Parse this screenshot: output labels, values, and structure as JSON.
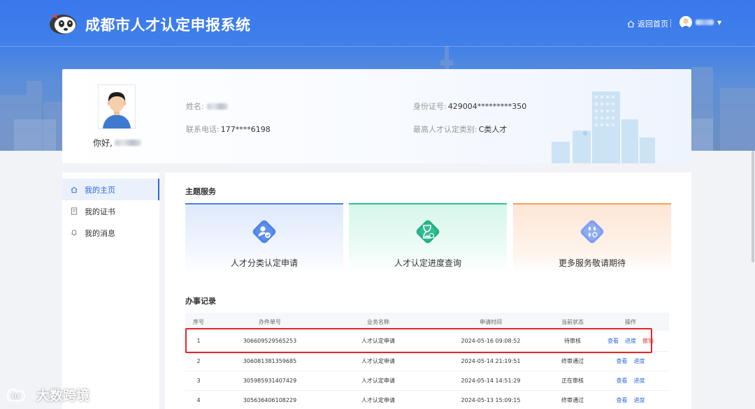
{
  "header": {
    "site_title": "成都市人才认定申报系统",
    "back_home": "返回首页",
    "user_name": ""
  },
  "profile": {
    "greeting": "你好,",
    "name_label": "姓名:",
    "phone_label": "联系电话:",
    "phone_value": "177****6198",
    "id_label": "身份证号:",
    "id_value": "429004*********350",
    "category_label": "最高人才认定类别:",
    "category_value": "C类人才"
  },
  "sidebar": {
    "items": [
      {
        "label": "我的主页",
        "icon": "home-icon",
        "active": true
      },
      {
        "label": "我的证书",
        "icon": "certificate-icon",
        "active": false
      },
      {
        "label": "我的消息",
        "icon": "bell-icon",
        "active": false
      }
    ]
  },
  "main": {
    "services_title": "主题服务",
    "services": [
      {
        "label": "人才分类认定申请",
        "icon": "user-check-icon",
        "accent": "#4a7fe6"
      },
      {
        "label": "人才认定进度查询",
        "icon": "hourglass-search-icon",
        "accent": "#2fc29a"
      },
      {
        "label": "更多服务敬请期待",
        "icon": "grid-more-icon",
        "accent": "#f1a45a"
      }
    ],
    "records_title": "办事记录",
    "table": {
      "headers": [
        "序号",
        "办件单号",
        "业务名称",
        "申请时间",
        "当前状态",
        "操作"
      ],
      "rows": [
        {
          "no": "1",
          "order": "306609529565253",
          "business": "人才认定申请",
          "time": "2024-05-16 09:08:52",
          "status": "待审核",
          "actions": [
            "查看",
            "进度",
            "撤销"
          ]
        },
        {
          "no": "2",
          "order": "306081381359685",
          "business": "人才认定申请",
          "time": "2024-05-14 21:19:51",
          "status": "终审通过",
          "actions": [
            "查看",
            "进度"
          ]
        },
        {
          "no": "3",
          "order": "305985931407429",
          "business": "人才认定申请",
          "time": "2024-05-14 14:51:29",
          "status": "正在审核",
          "actions": [
            "查看",
            "进度"
          ]
        },
        {
          "no": "4",
          "order": "305636406108229",
          "business": "人才认定申请",
          "time": "2024-05-13 15:09:15",
          "status": "终审通过",
          "actions": [
            "查看",
            "进度"
          ]
        }
      ]
    }
  },
  "watermark": "大数跨境",
  "colors": {
    "primary": "#2f6ae0",
    "danger": "#e04545",
    "highlight": "#e3262b"
  }
}
